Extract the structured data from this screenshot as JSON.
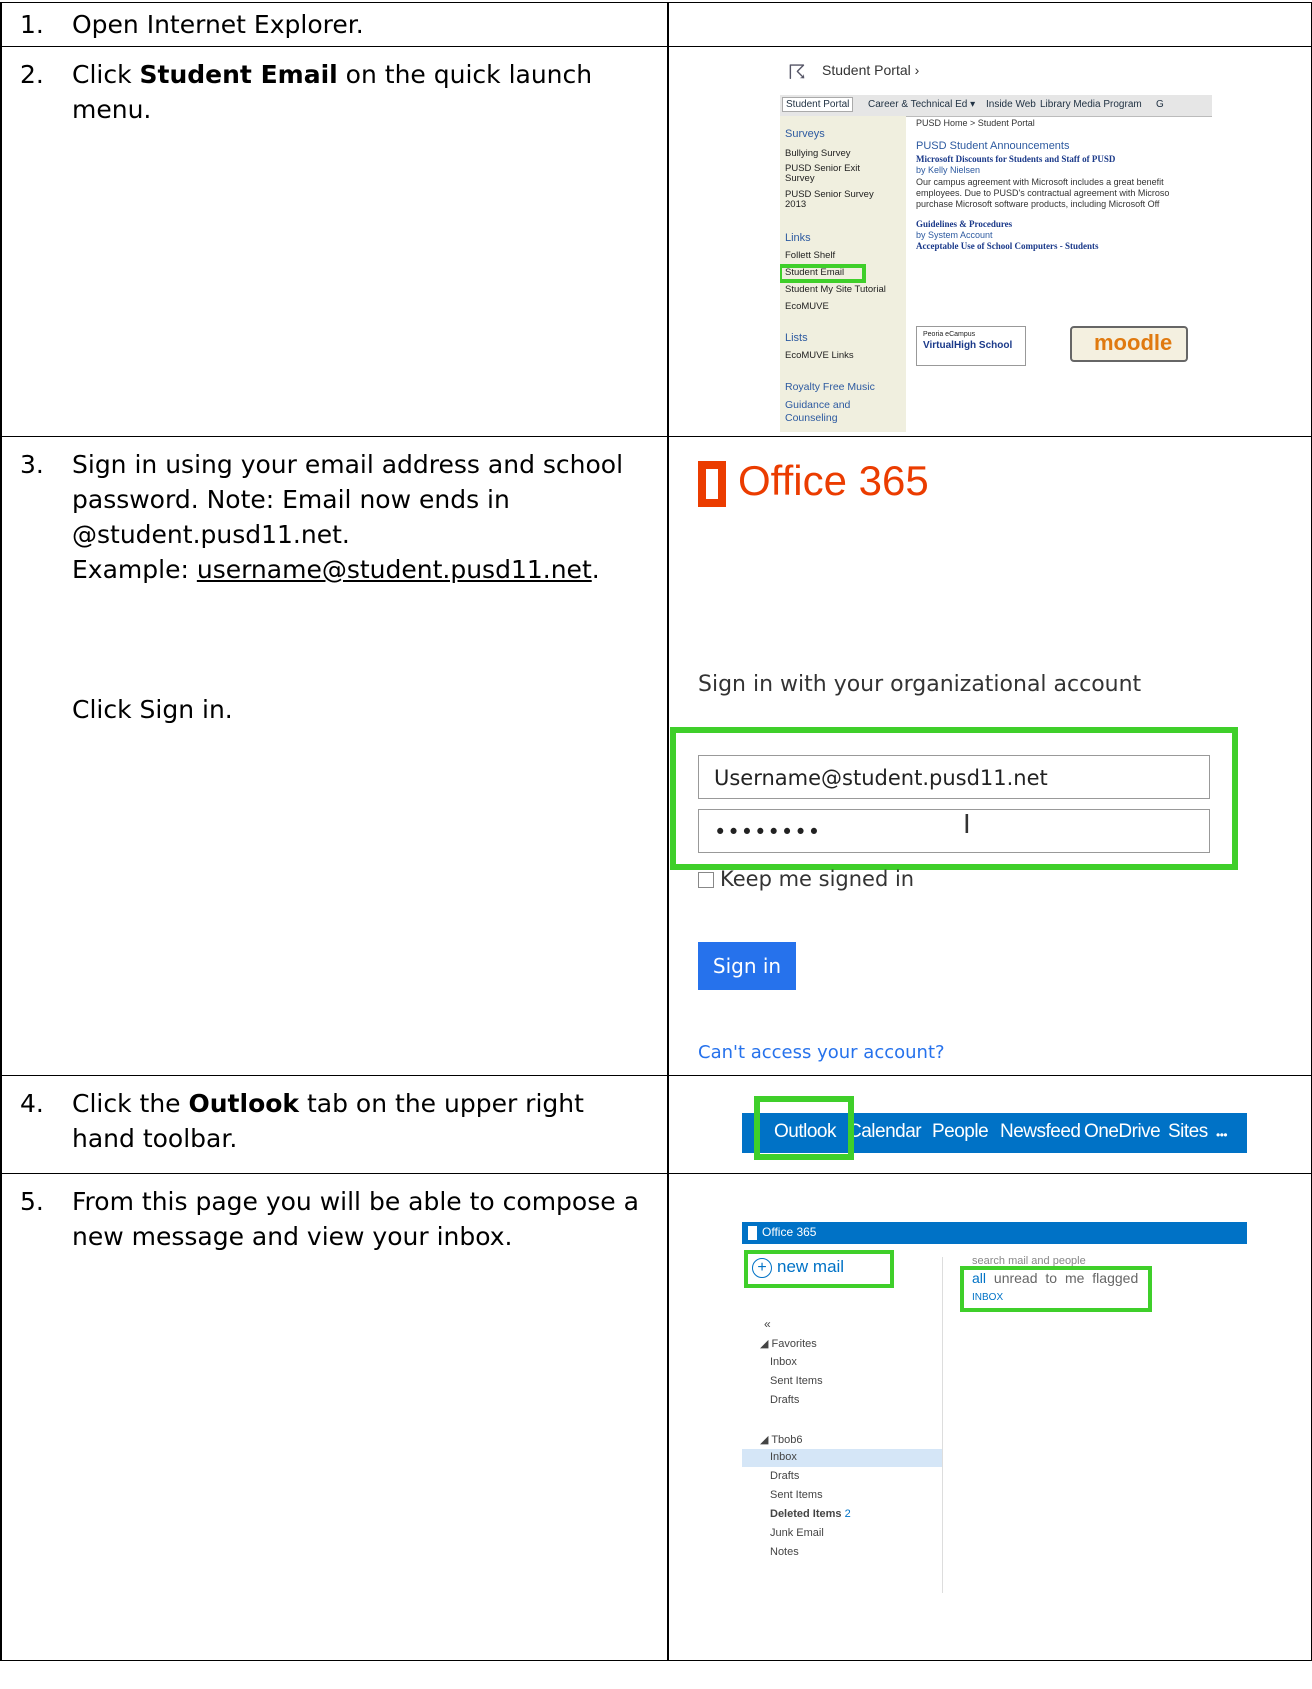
{
  "steps": [
    {
      "num": "1.",
      "text": "Open Internet Explorer."
    },
    {
      "num": "2.",
      "pre": "Click ",
      "bold": "Student Email",
      "post": " on the quick launch menu."
    },
    {
      "num": "3.",
      "line1": "Sign in using your email address and school password.  Note:  Email now ends in @student.pusd11.net.",
      "example_label": "Example: ",
      "example_link": "username@student.pusd11.net",
      "example_end": ".",
      "action": "Click Sign in."
    },
    {
      "num": "4.",
      "pre": "Click the ",
      "bold": "Outlook",
      "post": " tab on the upper right hand toolbar."
    },
    {
      "num": "5.",
      "text": "From this page you will be able to compose a new message and view your inbox."
    }
  ],
  "portal": {
    "title": "Student Portal ›",
    "nav": [
      "Student Portal",
      "Career & Technical Ed ▾",
      "Inside Web",
      "Library Media Program",
      "G"
    ],
    "breadcrumb": "PUSD Home > Student Portal",
    "side": {
      "surveys_header": "Surveys",
      "surveys": [
        "Bullying Survey",
        "PUSD Senior Exit Survey",
        "PUSD Senior Survey 2013"
      ],
      "links_header": "Links",
      "links": [
        "Follett Shelf",
        "Student Email",
        "Student My Site Tutorial",
        "EcoMUVE"
      ],
      "lists_header": "Lists",
      "lists": [
        "EcoMUVE Links"
      ],
      "royalty": "Royalty Free Music",
      "guidance": "Guidance and Counseling"
    },
    "announcements_title": "PUSD Student Announcements",
    "ann1_title": "Microsoft Discounts for Students and Staff of PUSD",
    "ann1_by": "by Kelly Nielsen",
    "ann1_body": [
      "Our campus agreement with Microsoft includes a great benefit",
      "employees.  Due to PUSD's contractual agreement with Microso",
      "purchase Microsoft software products, including Microsoft Off"
    ],
    "ann2_title": "Guidelines & Procedures",
    "ann2_by": "by System Account",
    "ann3_title": "Acceptable Use of School Computers - Students",
    "logo1_line1": "Peoria eCampus",
    "logo1_line2": "VirtualHigh School",
    "logo2": "moodle"
  },
  "office": {
    "brand": "Office 365",
    "title": "Sign in with your organizational account",
    "username": "Username@student.pusd11.net",
    "password": "••••••••",
    "keep": "Keep me signed in",
    "signin": "Sign in",
    "cant": "Can't access your account?"
  },
  "toolbar": {
    "items": [
      "Outlook",
      "Calendar",
      "People",
      "Newsfeed",
      "OneDrive",
      "Sites",
      "•••"
    ]
  },
  "owa": {
    "brand": "Office 365",
    "new_mail": "new mail",
    "search": "search mail and people",
    "filters": [
      "all",
      "unread",
      "to me",
      "flagged"
    ],
    "inbox_label": "INBOX",
    "collapse": "«",
    "favorites": "◢ Favorites",
    "fav_items": [
      "Inbox",
      "Sent Items",
      "Drafts"
    ],
    "account": "◢ Tbob6",
    "acct_items": [
      "Inbox",
      "Drafts",
      "Sent Items"
    ],
    "deleted": "Deleted Items",
    "deleted_count": "2",
    "more_items": [
      "Junk Email",
      "Notes"
    ]
  },
  "colors": {
    "highlight": "#3fcf2a",
    "office_orange": "#eb3c00",
    "office_blue": "#0072c6",
    "signin_blue": "#2672ec"
  }
}
